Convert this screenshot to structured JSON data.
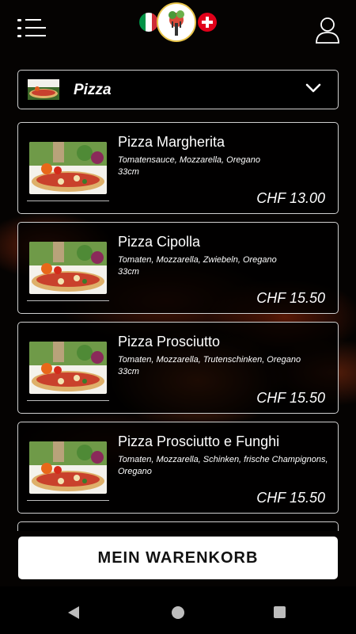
{
  "header": {
    "menu_icon": "hamburger-menu-icon",
    "logo_icon": "restaurant-logo-icon",
    "flags": [
      "italy-flag-icon",
      "switzerland-flag-icon"
    ],
    "account_icon": "user-icon"
  },
  "category": {
    "label": "Pizza",
    "chevron_icon": "chevron-down-icon"
  },
  "products": [
    {
      "name": "Pizza Margherita",
      "description": "Tomatensauce, Mozzarella, Oregano",
      "size": "33cm",
      "price": "CHF 13.00"
    },
    {
      "name": "Pizza Cipolla",
      "description": "Tomaten, Mozzarella, Zwiebeln, Oregano",
      "size": "33cm",
      "price": "CHF 15.50"
    },
    {
      "name": "Pizza Prosciutto",
      "description": "Tomaten, Mozzarella, Trutenschinken, Oregano",
      "size": "33cm",
      "price": "CHF 15.50"
    },
    {
      "name": "Pizza Prosciutto e Funghi",
      "description": "Tomaten, Mozzarella, Schinken, frische Champignons, Oregano",
      "size": "",
      "price": "CHF 15.50"
    }
  ],
  "cart_button": {
    "label": "MEIN WARENKORB"
  },
  "navbar": {
    "back_icon": "back-triangle-icon",
    "home_icon": "home-circle-icon",
    "recent_icon": "recent-apps-square-icon"
  },
  "colors": {
    "background": "#050302",
    "card_border": "#cfcfcf",
    "button_bg": "#ffffff",
    "text": "#ffffff"
  }
}
